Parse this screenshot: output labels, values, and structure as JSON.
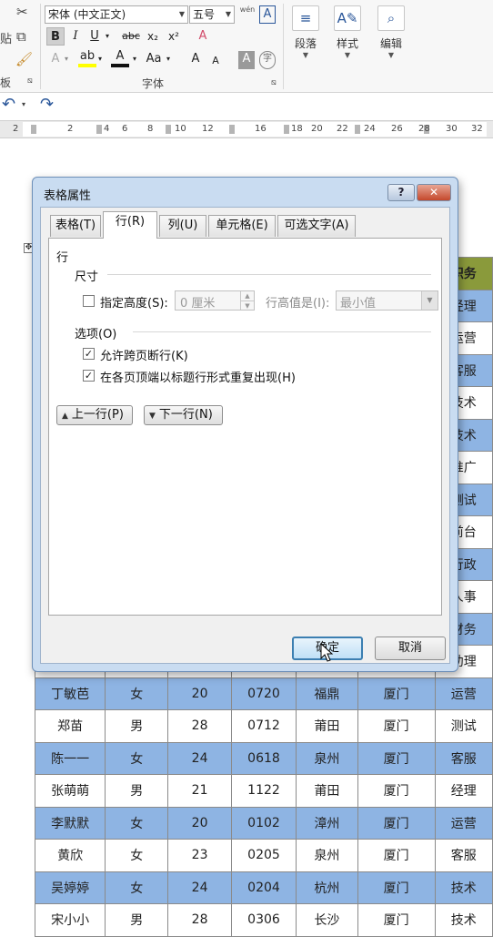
{
  "ribbon": {
    "clipboard_group_label": "板",
    "font_group_label": "字体",
    "font_name": "宋体 (中文正文)",
    "font_size": "五号",
    "bold_label": "B",
    "italic_label": "I",
    "underline_label": "U",
    "strike_label": "abc",
    "subscript_label": "x₂",
    "superscript_label": "x²",
    "clear_format_glyph": "A",
    "char_border_glyph": "A",
    "pinyin_glyph": "wén",
    "text_effect_glyph": "A",
    "font_color_glyph": "A",
    "case_label": "Aa",
    "grow_font_label": "A",
    "shrink_font_label": "A",
    "char_shading_glyph": "A",
    "enclosed_glyph": "字",
    "paragraph_label": "段落",
    "styles_label": "样式",
    "editing_label": "编辑",
    "paste_label": "贴"
  },
  "ruler": {
    "ticks": [
      "2",
      "2",
      "4",
      "6",
      "8",
      "10",
      "12",
      "16",
      "18",
      "20",
      "22",
      "24",
      "26",
      "28",
      "30",
      "32"
    ]
  },
  "table": {
    "header_partial": "职务",
    "rows": [
      {
        "cells": [
          "",
          "",
          "",
          "",
          "",
          "",
          "经理"
        ],
        "blue": true
      },
      {
        "cells": [
          "",
          "",
          "",
          "",
          "",
          "",
          "运营"
        ],
        "blue": false
      },
      {
        "cells": [
          "",
          "",
          "",
          "",
          "",
          "",
          "客服"
        ],
        "blue": true
      },
      {
        "cells": [
          "",
          "",
          "",
          "",
          "",
          "",
          "技术"
        ],
        "blue": false
      },
      {
        "cells": [
          "",
          "",
          "",
          "",
          "",
          "",
          "技术"
        ],
        "blue": true
      },
      {
        "cells": [
          "",
          "",
          "",
          "",
          "",
          "",
          "推广"
        ],
        "blue": false
      },
      {
        "cells": [
          "",
          "",
          "",
          "",
          "",
          "",
          "测试"
        ],
        "blue": true
      },
      {
        "cells": [
          "",
          "",
          "",
          "",
          "",
          "",
          "前台"
        ],
        "blue": false
      },
      {
        "cells": [
          "",
          "",
          "",
          "",
          "",
          "",
          "行政"
        ],
        "blue": true
      },
      {
        "cells": [
          "",
          "",
          "",
          "",
          "",
          "",
          "人事"
        ],
        "blue": false
      },
      {
        "cells": [
          "",
          "",
          "",
          "",
          "",
          "",
          "财务"
        ],
        "blue": true
      },
      {
        "cells": [
          "",
          "",
          "",
          "",
          "",
          "",
          "助理"
        ],
        "blue": false
      },
      {
        "cells": [
          "丁敏芭",
          "女",
          "20",
          "0720",
          "福鼎",
          "厦门",
          "运营"
        ],
        "blue": true
      },
      {
        "cells": [
          "郑苗",
          "男",
          "28",
          "0712",
          "莆田",
          "厦门",
          "测试"
        ],
        "blue": false
      },
      {
        "cells": [
          "陈一一",
          "女",
          "24",
          "0618",
          "泉州",
          "厦门",
          "客服"
        ],
        "blue": true
      },
      {
        "cells": [
          "张萌萌",
          "男",
          "21",
          "1122",
          "莆田",
          "厦门",
          "经理"
        ],
        "blue": false
      },
      {
        "cells": [
          "李默默",
          "女",
          "20",
          "0102",
          "漳州",
          "厦门",
          "运营"
        ],
        "blue": true
      },
      {
        "cells": [
          "黄欣",
          "女",
          "23",
          "0205",
          "泉州",
          "厦门",
          "客服"
        ],
        "blue": false
      },
      {
        "cells": [
          "吴婷婷",
          "女",
          "24",
          "0204",
          "杭州",
          "厦门",
          "技术"
        ],
        "blue": true
      },
      {
        "cells": [
          "宋小小",
          "男",
          "28",
          "0306",
          "长沙",
          "厦门",
          "技术"
        ],
        "blue": false
      }
    ]
  },
  "dialog": {
    "title": "表格属性",
    "help_label": "?",
    "close_label": "✕",
    "tabs": [
      "表格(T)",
      "行(R)",
      "列(U)",
      "单元格(E)",
      "可选文字(A)"
    ],
    "active_tab": "行(R)",
    "section_row": "行",
    "size_label": "尺寸",
    "specify_height_label": "指定高度(S):",
    "height_value": "0 厘米",
    "row_height_is_label": "行高值是(I):",
    "row_height_mode": "最小值",
    "options_label": "选项(O)",
    "allow_break_label": "允许跨页断行(K)",
    "repeat_header_label": "在各页顶端以标题行形式重复出现(H)",
    "specify_height_checked": false,
    "allow_break_checked": true,
    "repeat_header_checked": true,
    "prev_row_label": "上一行(P)",
    "next_row_label": "下一行(N)",
    "ok_label": "确定",
    "cancel_label": "取消"
  }
}
